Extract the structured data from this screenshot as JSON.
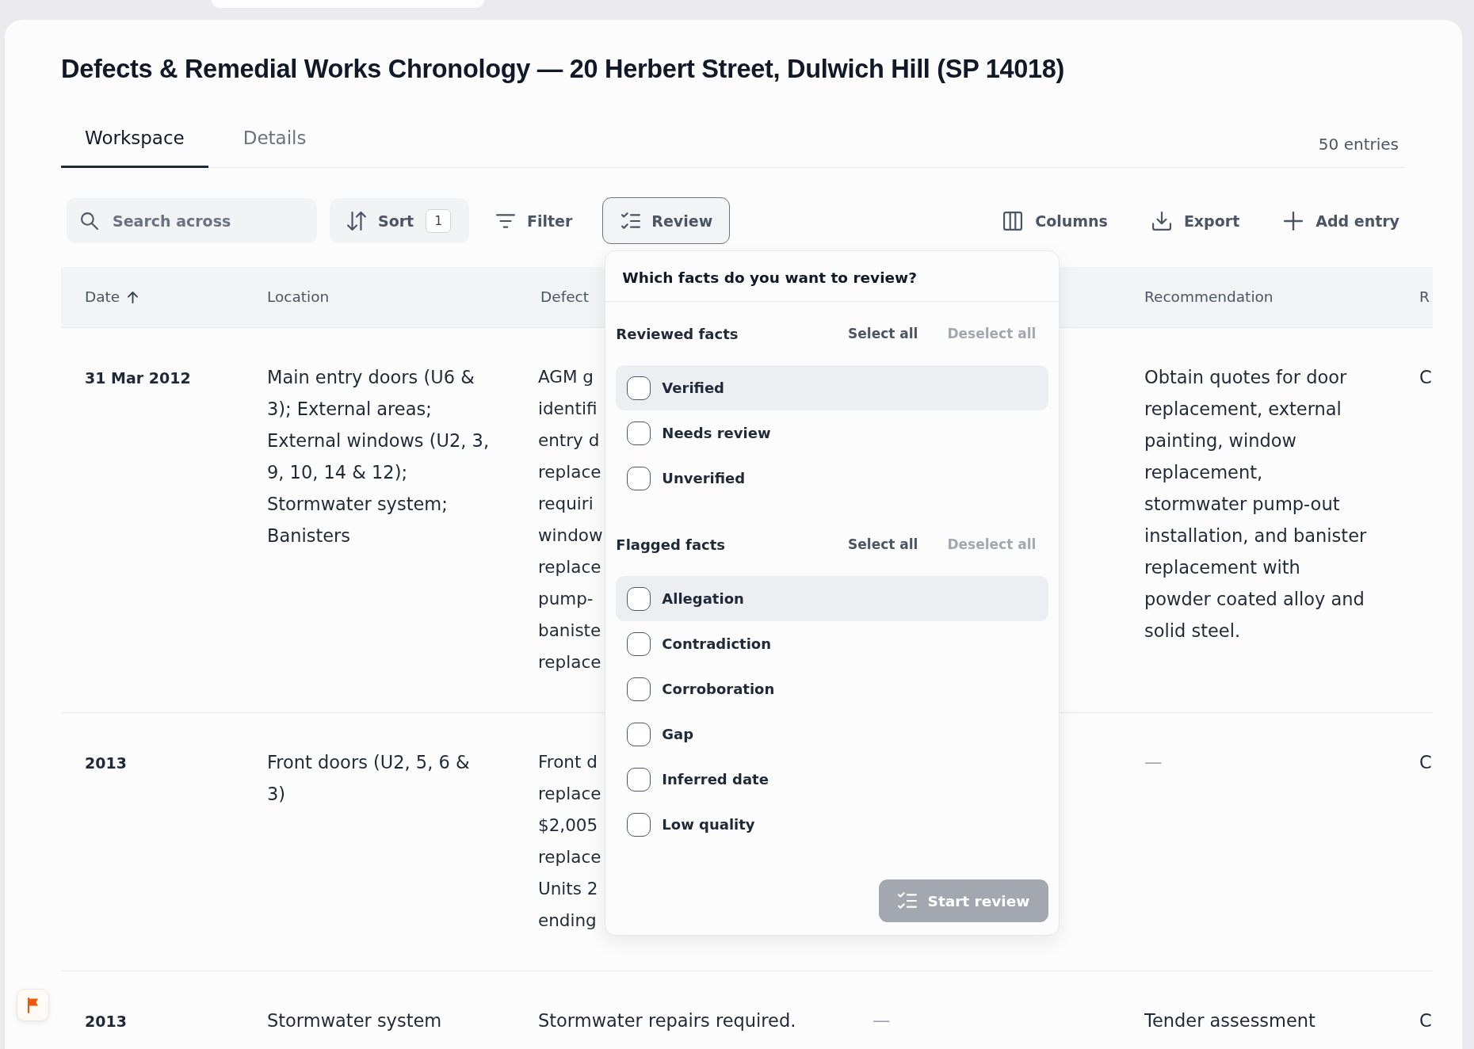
{
  "title": "Defects & Remedial Works Chronology — 20 Herbert Street, Dulwich Hill (SP 14018)",
  "tabs": [
    {
      "label": "Workspace",
      "selected": true
    },
    {
      "label": "Details",
      "selected": false
    }
  ],
  "entry_count": "50 entries",
  "toolbar": {
    "search": {
      "placeholder": "Search across"
    },
    "sort": {
      "label": "Sort",
      "count": "1"
    },
    "filter": {
      "label": "Filter"
    },
    "review": {
      "label": "Review",
      "open": true
    },
    "actions": [
      {
        "kind": "columns",
        "label": "Columns"
      },
      {
        "kind": "export",
        "label": "Export"
      },
      {
        "kind": "add",
        "label": "Add entry"
      }
    ]
  },
  "review_popover": {
    "title": "Which facts do you want to review?",
    "groups": [
      {
        "label": "Reviewed facts",
        "select_all": {
          "label": "Select all",
          "disabled": false
        },
        "deselect_all": {
          "label": "Deselect all",
          "disabled": true
        },
        "options": [
          {
            "label": "Verified",
            "checked": false,
            "highlighted": true
          },
          {
            "label": "Needs review",
            "checked": false,
            "highlighted": false
          },
          {
            "label": "Unverified",
            "checked": false,
            "highlighted": false
          }
        ]
      },
      {
        "label": "Flagged facts",
        "select_all": {
          "label": "Select all",
          "disabled": false
        },
        "deselect_all": {
          "label": "Deselect all",
          "disabled": true
        },
        "options": [
          {
            "label": "Allegation",
            "checked": false,
            "highlighted": true
          },
          {
            "label": "Contradiction",
            "checked": false,
            "highlighted": false
          },
          {
            "label": "Corroboration",
            "checked": false,
            "highlighted": false
          },
          {
            "label": "Gap",
            "checked": false,
            "highlighted": false
          },
          {
            "label": "Inferred date",
            "checked": false,
            "highlighted": false
          },
          {
            "label": "Low quality",
            "checked": false,
            "highlighted": false
          }
        ]
      }
    ],
    "submit": {
      "label": "Start review",
      "disabled": true
    }
  },
  "table": {
    "columns": [
      {
        "label": "Date",
        "sorted": true
      },
      {
        "label": "Location",
        "sorted": false
      },
      {
        "label": "Defect",
        "sorted": false
      },
      null,
      {
        "label": "Recommendation",
        "sorted": false
      },
      {
        "label": "R",
        "sorted": false
      }
    ],
    "rows": [
      {
        "cells": [
          {
            "kind": "date",
            "text": "31 Mar 2012"
          },
          {
            "kind": "text",
            "text": "Main entry doors (U6 & 3); External areas; External windows (U2, 3, 9, 10, 14 & 12); Stormwater system; Banisters"
          },
          {
            "kind": "clipped",
            "lines": [
              "AGM g",
              "identifi",
              "entry d",
              "replace",
              "requiri",
              "window",
              "replace",
              "pump-",
              "baniste",
              "replace"
            ]
          },
          null,
          {
            "kind": "text",
            "text": "Obtain quotes for door replacement, external painting, window replacement, stormwater pump-out installation, and banister replacement with powder coated alloy and solid steel."
          },
          {
            "kind": "text",
            "text": "C"
          }
        ]
      },
      {
        "cells": [
          {
            "kind": "date",
            "text": "2013"
          },
          {
            "kind": "text",
            "text": "Front doors (U2, 5, 6 & 3)"
          },
          {
            "kind": "clipped",
            "lines": [
              "Front d",
              "replace",
              "$2,005",
              "replace",
              "Units 2",
              "ending"
            ]
          },
          null,
          {
            "kind": "empty",
            "text": "—"
          },
          {
            "kind": "text",
            "text": "C"
          }
        ]
      },
      {
        "cells": [
          {
            "kind": "date",
            "text": "2013"
          },
          {
            "kind": "text",
            "text": "Stormwater system"
          },
          {
            "kind": "text",
            "text": "Stormwater repairs required."
          },
          {
            "kind": "empty",
            "text": "—"
          },
          {
            "kind": "text",
            "text": "Tender assessment"
          },
          {
            "kind": "text",
            "text": "C"
          }
        ]
      }
    ]
  }
}
